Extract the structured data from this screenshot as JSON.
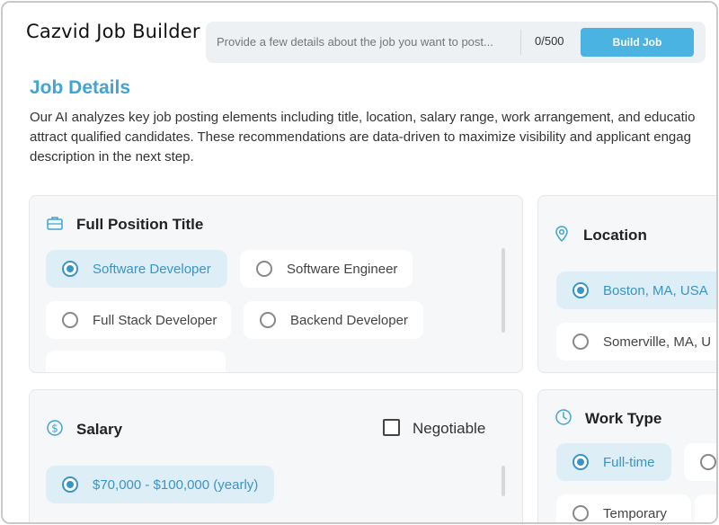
{
  "app": {
    "title": "Cazvid Job Builder"
  },
  "prompt": {
    "placeholder": "Provide a few details about the job you want to post...",
    "counter": "0/500",
    "build_label": "Build Job"
  },
  "section": {
    "title": "Job Details",
    "description": "Our AI analyzes key job posting elements including title, location, salary range, work arrangement, and educatio\nattract qualified candidates. These recommendations are data-driven to maximize visibility and applicant engag\ndescription in the next step."
  },
  "position": {
    "title": "Full Position Title",
    "icon": "briefcase-icon",
    "options": [
      {
        "label": "Software Developer",
        "selected": true
      },
      {
        "label": "Software Engineer",
        "selected": false
      },
      {
        "label": "Full Stack Developer",
        "selected": false
      },
      {
        "label": "Backend Developer",
        "selected": false
      }
    ]
  },
  "location": {
    "title": "Location",
    "icon": "map-pin-icon",
    "options": [
      {
        "label": "Boston, MA, USA",
        "selected": true
      },
      {
        "label": "Somerville, MA, U",
        "selected": false
      }
    ]
  },
  "salary": {
    "title": "Salary",
    "icon": "dollar-icon",
    "negotiable_label": "Negotiable",
    "negotiable_checked": false,
    "options": [
      {
        "label": "$70,000 - $100,000 (yearly)",
        "selected": true
      }
    ]
  },
  "work_type": {
    "title": "Work Type",
    "icon": "clock-icon",
    "options": [
      {
        "label": "Full-time",
        "selected": true
      },
      {
        "label": "Temporary",
        "selected": false
      }
    ]
  },
  "colors": {
    "accent": "#3fa4d6",
    "button": "#4ab3e2",
    "selected_bg": "#ddeef7"
  }
}
